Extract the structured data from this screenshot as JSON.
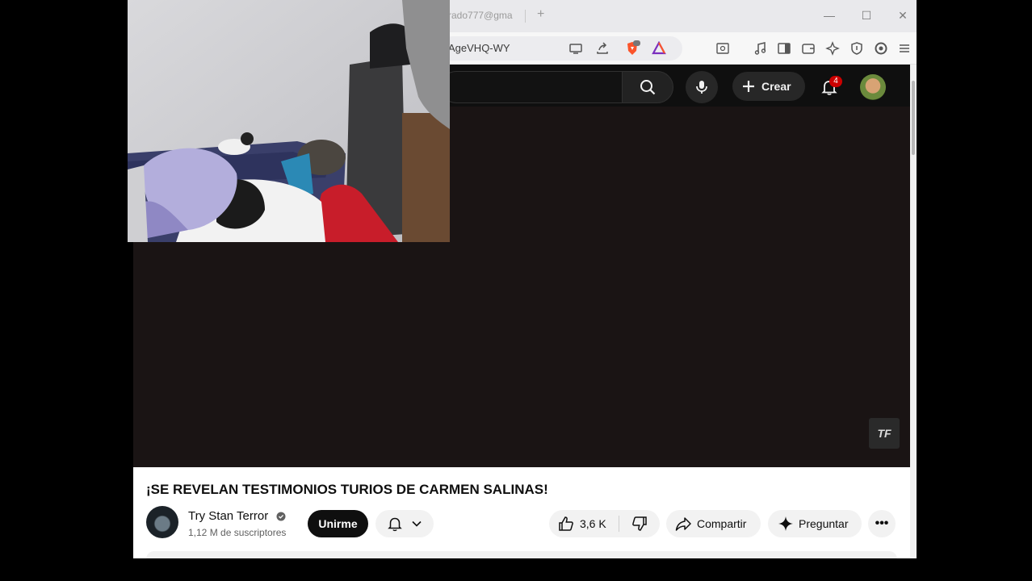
{
  "browser": {
    "tab_title": "rado777@gma",
    "new_tab": "+",
    "window_controls": {
      "minimize": "—",
      "maximize": "☐",
      "close": "✕"
    },
    "url_visible": "AgeVHQ-WY",
    "toolbar_icons": [
      "cast-icon",
      "share-icon",
      "brave-shield-icon",
      "brave-rewards-icon",
      "reader-mode-icon",
      "media-icon",
      "sidebar-icon",
      "wallet-icon",
      "leo-ai-icon",
      "vpn-icon",
      "brave-logo-icon",
      "menu-icon"
    ]
  },
  "youtube": {
    "create_label": "Crear",
    "notification_count": "4",
    "video_watermark": "TF",
    "video": {
      "title": "¡SE REVELAN TESTIMONIOS TURIOS DE CARMEN SALINAS!",
      "channel_name": "Try Stan Terror",
      "subscribers": "1,12 M de suscriptores",
      "join_label": "Unirme",
      "like_count": "3,6 K",
      "share_label": "Compartir",
      "ask_label": "Preguntar",
      "more_label": "•••"
    }
  },
  "colors": {
    "yt_dark": "#0f0f0f",
    "player_bg": "#1a1414",
    "badge_red": "#cc0000",
    "brave_orange": "#fb542b",
    "brave_purple": "#7b2fbe"
  }
}
